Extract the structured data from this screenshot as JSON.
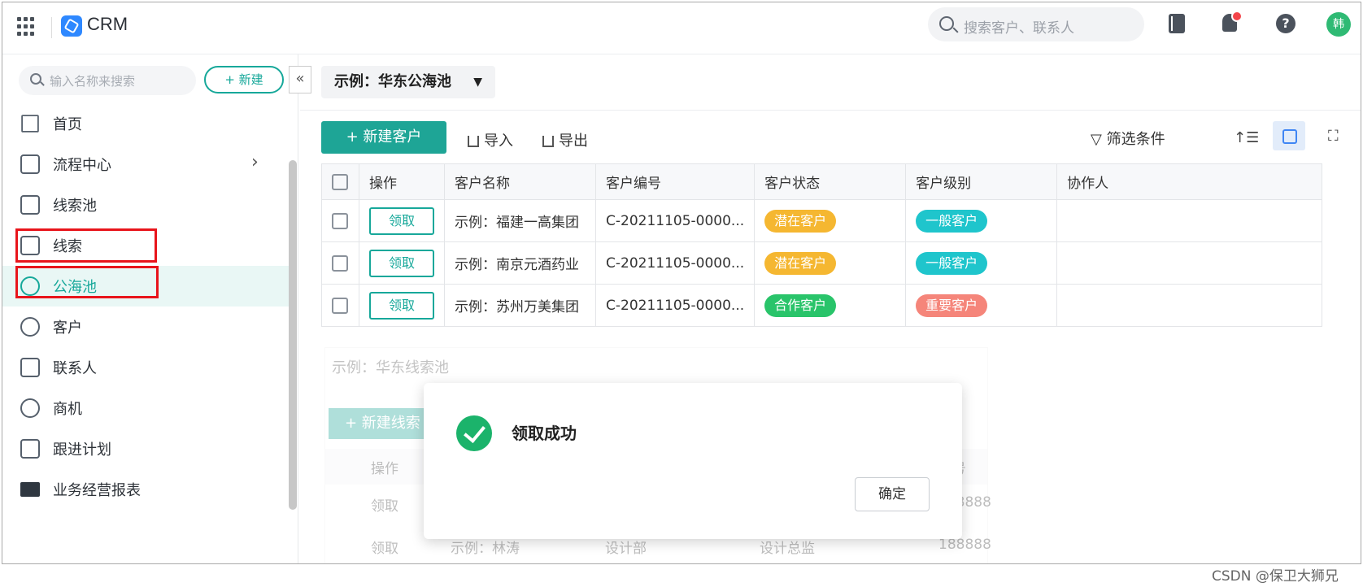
{
  "topbar": {
    "app_title": "CRM",
    "search_placeholder": "搜索客户、联系人",
    "avatar_text": "韩",
    "help_symbol": "?"
  },
  "sidebar": {
    "search_placeholder": "输入名称来搜索",
    "new_button": "+ 新建",
    "collapse_symbol": "«",
    "items": [
      {
        "label": "首页",
        "icon": "home-icon"
      },
      {
        "label": "流程中心",
        "icon": "flow-icon",
        "has_chevron": true
      },
      {
        "label": "线索池",
        "icon": "lead-pool-icon"
      },
      {
        "label": "线索",
        "icon": "lead-icon",
        "highlighted": true
      },
      {
        "label": "公海池",
        "icon": "public-pool-icon",
        "highlighted": true,
        "active": true
      },
      {
        "label": "客户",
        "icon": "customer-icon"
      },
      {
        "label": "联系人",
        "icon": "contact-icon"
      },
      {
        "label": "商机",
        "icon": "opportunity-icon"
      },
      {
        "label": "跟进计划",
        "icon": "plan-icon"
      },
      {
        "label": "业务经营报表",
        "icon": "folder-icon"
      }
    ]
  },
  "main": {
    "pool_selector": "示例：华东公海池",
    "toolbar": {
      "new_customer": "+ 新建客户",
      "import": "导入",
      "export": "导出",
      "filter": "筛选条件"
    },
    "table": {
      "headers": [
        "操作",
        "客户名称",
        "客户编号",
        "客户状态",
        "客户级别",
        "协作人"
      ],
      "rows": [
        {
          "action": "领取",
          "name": "示例：福建一高集团",
          "code": "C-20211105-0000...",
          "status": "潜在客户",
          "status_color": "#f5b731",
          "level": "一般客户",
          "level_color": "#1fc5cc",
          "collaborator": ""
        },
        {
          "action": "领取",
          "name": "示例：南京元酒药业",
          "code": "C-20211105-0000...",
          "status": "潜在客户",
          "status_color": "#f5b731",
          "level": "一般客户",
          "level_color": "#1fc5cc",
          "collaborator": ""
        },
        {
          "action": "领取",
          "name": "示例：苏州万美集团",
          "code": "C-20211105-0000...",
          "status": "合作客户",
          "status_color": "#29c46a",
          "level": "重要客户",
          "level_color": "#f5857a",
          "collaborator": ""
        }
      ]
    }
  },
  "background_page": {
    "pool_selector": "示例：华东线索池",
    "new_button": "+ 新建线索",
    "header_action": "操作",
    "header_phone_partial": "机号",
    "row1_action": "领取",
    "row1_phone_partial": "188888",
    "row2_action": "领取",
    "row2_name": "示例：林涛",
    "row2_dept": "设计部",
    "row2_title": "设计总监",
    "row2_phone_partial": "188888"
  },
  "dialog": {
    "message": "领取成功",
    "confirm": "确定"
  },
  "watermark": "CSDN @保卫大狮兄"
}
